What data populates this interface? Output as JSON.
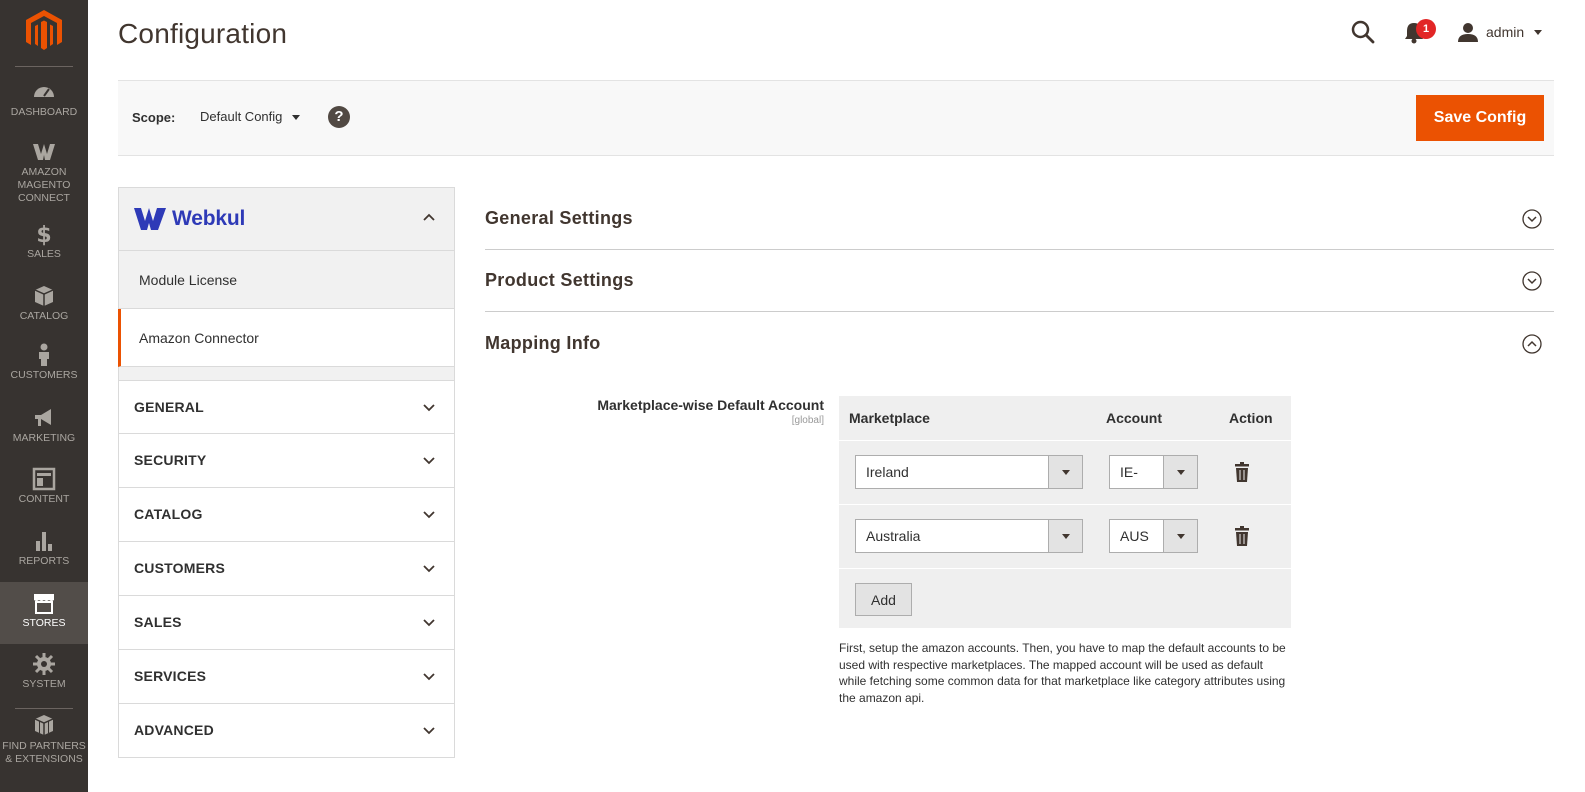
{
  "nav": {
    "items": [
      {
        "label": "DASHBOARD",
        "icon": "dashboard-icon"
      },
      {
        "label": "AMAZON MAGENTO CONNECT",
        "icon": "webkul-icon"
      },
      {
        "label": "SALES",
        "icon": "dollar-icon"
      },
      {
        "label": "CATALOG",
        "icon": "box-icon"
      },
      {
        "label": "CUSTOMERS",
        "icon": "person-icon"
      },
      {
        "label": "MARKETING",
        "icon": "megaphone-icon"
      },
      {
        "label": "CONTENT",
        "icon": "layout-icon"
      },
      {
        "label": "REPORTS",
        "icon": "bar-chart-icon"
      },
      {
        "label": "STORES",
        "icon": "store-icon"
      },
      {
        "label": "SYSTEM",
        "icon": "gear-icon"
      },
      {
        "label": "FIND PARTNERS & EXTENSIONS",
        "icon": "cubes-icon"
      }
    ],
    "active": "STORES"
  },
  "header": {
    "title": "Configuration",
    "notification_count": "1",
    "user": "admin"
  },
  "scope": {
    "label": "Scope:",
    "value": "Default Config",
    "help": "?",
    "save_label": "Save Config"
  },
  "tabs": {
    "brand": "Webkul",
    "sub_items": [
      "Module License",
      "Amazon Connector"
    ],
    "active_sub": "Amazon Connector",
    "sections": [
      "GENERAL",
      "SECURITY",
      "CATALOG",
      "CUSTOMERS",
      "SALES",
      "SERVICES",
      "ADVANCED"
    ]
  },
  "main": {
    "sections": [
      "General Settings",
      "Product Settings",
      "Mapping Info"
    ],
    "field_label": "Marketplace-wise Default Account",
    "field_scope": "[global]",
    "columns": [
      "Marketplace",
      "Account",
      "Action"
    ],
    "rows": [
      {
        "marketplace": "Ireland",
        "account": "IE-"
      },
      {
        "marketplace": "Australia",
        "account": "AUS"
      }
    ],
    "add_label": "Add",
    "note": "First, setup the amazon accounts. Then, you have to map the default accounts to be used with respective marketplaces. The mapped account will be used as default while fetching some common data for that marketplace like category attributes using the amazon api."
  },
  "colors": {
    "accent": "#eb5202",
    "nav_bg": "#373330",
    "brand": "#2e3ab7",
    "badge": "#e22626"
  }
}
